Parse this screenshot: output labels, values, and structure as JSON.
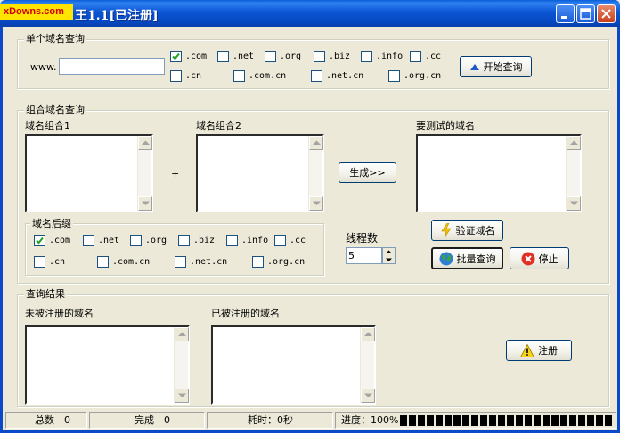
{
  "window": {
    "logo_text": "xDowns.com",
    "title": "王1.1[已注册]",
    "colors": {
      "titlebar": "#0b55d4",
      "face": "#ece9d8",
      "logo_bg": "#ffe400",
      "logo_fg": "#d00000"
    },
    "controls": {
      "minimize_icon": "minimize-icon",
      "maximize_icon": "maximize-icon",
      "close_icon": "close-icon"
    }
  },
  "single_query": {
    "title": "单个域名查询",
    "www_label": "www.",
    "domain_input_value": "",
    "tlds": [
      {
        "label": ".com",
        "checked": true
      },
      {
        "label": ".net",
        "checked": false
      },
      {
        "label": ".org",
        "checked": false
      },
      {
        "label": ".biz",
        "checked": false
      },
      {
        "label": ".info",
        "checked": false
      },
      {
        "label": ".cc",
        "checked": false
      },
      {
        "label": ".cn",
        "checked": false
      },
      {
        "label": ".com.cn",
        "checked": false
      },
      {
        "label": ".net.cn",
        "checked": false
      },
      {
        "label": ".org.cn",
        "checked": false
      }
    ],
    "start_button": "开始查询"
  },
  "combo_query": {
    "title": "组合域名查询",
    "combo1_label": "域名组合1",
    "combo2_label": "域名组合2",
    "plus": "+",
    "generate_button": "生成>>",
    "target_label": "要测试的域名",
    "suffix_group_title": "域名后缀",
    "suffixes": [
      {
        "label": ".com",
        "checked": true
      },
      {
        "label": ".net",
        "checked": false
      },
      {
        "label": ".org",
        "checked": false
      },
      {
        "label": ".biz",
        "checked": false
      },
      {
        "label": ".info",
        "checked": false
      },
      {
        "label": ".cc",
        "checked": false
      },
      {
        "label": ".cn",
        "checked": false
      },
      {
        "label": ".com.cn",
        "checked": false
      },
      {
        "label": ".net.cn",
        "checked": false
      },
      {
        "label": ".org.cn",
        "checked": false
      }
    ],
    "threads_label": "线程数",
    "threads_value": "5",
    "verify_button": "验证域名",
    "batch_button": "批量查询",
    "stop_button": "停止"
  },
  "results": {
    "title": "查询结果",
    "unregistered_label": "未被注册的域名",
    "registered_label": "已被注册的域名",
    "register_button": "注册"
  },
  "status": {
    "total": "总数　0",
    "done": "完成　0",
    "elapsed": "耗时：0秒",
    "progress_label": "进度：100%",
    "progress_fraction": 1.0
  }
}
